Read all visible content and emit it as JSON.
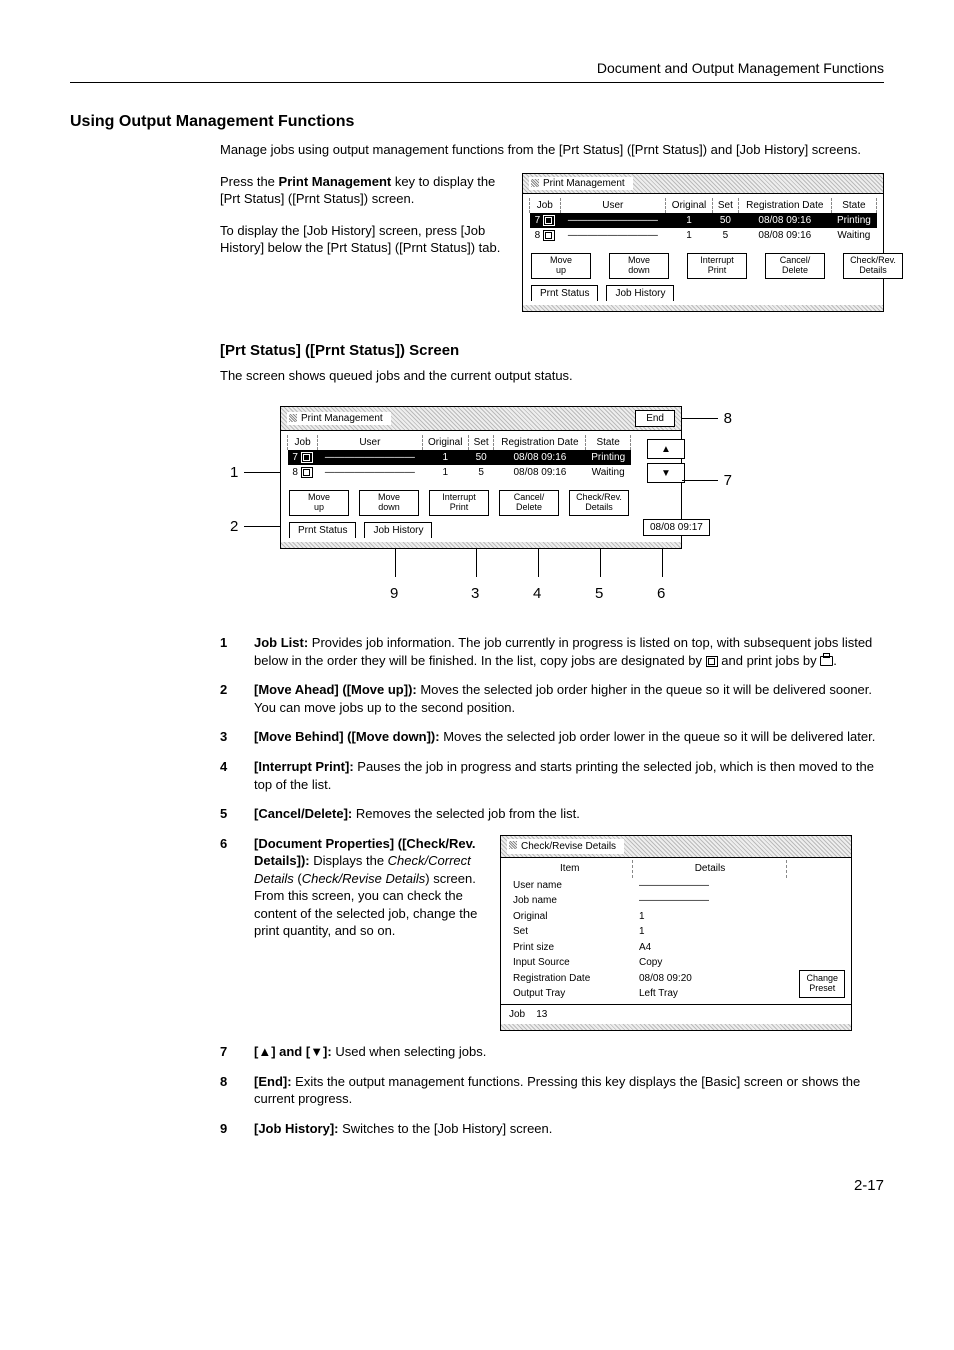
{
  "header": {
    "doc_title": "Document and Output Management Functions"
  },
  "section_title": "Using Output Management Functions",
  "intro": "Manage jobs using output management functions from the [Prt Status] ([Prnt Status]) and [Job History] screens.",
  "para1a": "Press the ",
  "para1b": "Print Management",
  "para1c": " key to display the [Prt Status] ([Prnt Status]) screen.",
  "para2": "To display the [Job History] screen, press [Job History] below the [Prt Status] ([Prnt Status]) tab.",
  "panel1": {
    "title": "Print Management",
    "headers": [
      "Job",
      "User",
      "Original",
      "Set",
      "Registration Date",
      "State"
    ],
    "row1": [
      "7",
      "—————————",
      "1",
      "50",
      "08/08  09:16",
      "Printing"
    ],
    "row2": [
      "8",
      "—————————",
      "1",
      "5",
      "08/08  09:16",
      "Waiting"
    ],
    "keys": [
      "Move\nup",
      "Move\ndown",
      "Interrupt\nPrint",
      "Cancel/\nDelete",
      "Check/Rev.\nDetails"
    ],
    "tabs": [
      "Prnt Status",
      "Job History"
    ]
  },
  "sub_title": "[Prt Status] ([Prnt Status]) Screen",
  "sub_intro": "The screen shows queued jobs and the current output status.",
  "panel2": {
    "title": "Print Management",
    "end": "End",
    "headers": [
      "Job",
      "User",
      "Original",
      "Set",
      "Registration Date",
      "State"
    ],
    "row1": [
      "7",
      "—————————",
      "1",
      "50",
      "08/08  09:16",
      "Printing"
    ],
    "row2": [
      "8",
      "—————————",
      "1",
      "5",
      "08/08  09:16",
      "Waiting"
    ],
    "keys": [
      "Move\nup",
      "Move\ndown",
      "Interrupt\nPrint",
      "Cancel/\nDelete",
      "Check/Rev.\nDetails"
    ],
    "tabs": [
      "Prnt Status",
      "Job History"
    ],
    "time": "08/08 09:17"
  },
  "callouts_bottom": [
    "9",
    "3",
    "4",
    "5",
    "6"
  ],
  "callout_left": [
    "1",
    "2"
  ],
  "callout_right": [
    "8",
    "7"
  ],
  "desc": {
    "d1a": "Job List:",
    "d1b": " Provides job information. The job currently in progress is listed on top, with subsequent jobs listed below in the order they will be finished. In the list, copy jobs are designated by ",
    "d1c": " and print jobs by ",
    "d1d": ".",
    "d2a": "[Move Ahead] ([Move up]):",
    "d2b": " Moves the selected job order higher in the queue so it will be delivered sooner. You can move jobs up to the second position.",
    "d3a": "[Move Behind] ([Move down]):",
    "d3b": " Moves the selected job order lower in the queue so it will be delivered later.",
    "d4a": "[Interrupt Print]:",
    "d4b": " Pauses the job in progress and starts printing the selected job, which is then moved to the top of the list.",
    "d5a": "[Cancel/Delete]:",
    "d5b": " Removes the selected job from the list.",
    "d6a": "[Document Properties] ([Check/Rev. Details]):",
    "d6b": " Displays the ",
    "d6c": "Check/Correct Details",
    "d6d": " (",
    "d6e": "Check/Revise Details",
    "d6f": ") screen. From this screen, you can check the content of the selected job, change the print quantity, and so on.",
    "d7a": "[▲] and [▼]:",
    "d7b": " Used when selecting jobs.",
    "d8a": "[End]:",
    "d8b": " Exits the output management functions. Pressing this key displays the [Basic] screen or shows the current progress.",
    "d9a": "[Job History]:",
    "d9b": " Switches to the [Job History] screen."
  },
  "panel3": {
    "title": "Check/Revise Details",
    "col1": "Item",
    "col2": "Details",
    "rows": [
      [
        "User name",
        "———————"
      ],
      [
        "Job name",
        "———————"
      ],
      [
        "Original",
        "1"
      ],
      [
        "Set",
        "1"
      ],
      [
        "Print size",
        "A4"
      ],
      [
        "Input Source",
        "Copy"
      ],
      [
        "Registration Date",
        "08/08 09:20"
      ],
      [
        "Output Tray",
        "Left Tray"
      ]
    ],
    "change": "Change\nPreset",
    "job_label": "Job",
    "job_no": "13"
  },
  "page_number": "2-17"
}
